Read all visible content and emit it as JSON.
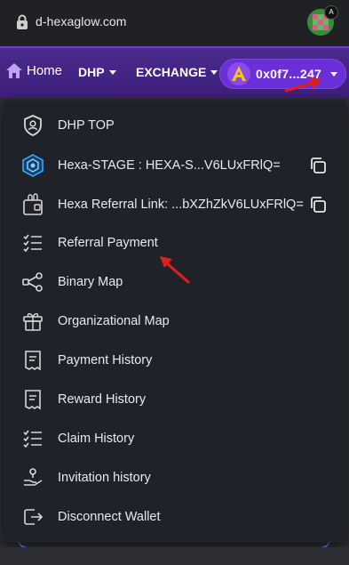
{
  "browser": {
    "url": "d-hexaglow.com",
    "avatar_badge": "A"
  },
  "nav": {
    "home_label": "Home",
    "dhp_label": "DHP",
    "exchange_label": "EXCHANGE",
    "wallet_address": "0x0f7...247"
  },
  "menu": {
    "items": [
      {
        "label": "DHP TOP",
        "icon": "shield-user-icon"
      },
      {
        "label": "Hexa-STAGE : HEXA-S...V6LUxFRlQ=",
        "icon": "hexagon-stage-icon",
        "copy": true
      },
      {
        "label": "Hexa Referral Link: ...bXZhZkV6LUxFRlQ=",
        "icon": "referral-link-icon",
        "copy": true
      },
      {
        "label": "Referral Payment",
        "icon": "checklist-icon"
      },
      {
        "label": "Binary Map",
        "icon": "share-nodes-icon"
      },
      {
        "label": "Organizational Map",
        "icon": "gift-box-icon"
      },
      {
        "label": "Payment History",
        "icon": "receipt-icon"
      },
      {
        "label": "Reward History",
        "icon": "receipt-icon"
      },
      {
        "label": "Claim History",
        "icon": "checklist-icon"
      },
      {
        "label": "Invitation history",
        "icon": "hand-coin-icon"
      },
      {
        "label": "Disconnect Wallet",
        "icon": "logout-icon"
      }
    ]
  },
  "colors": {
    "nav_bg": "#4a2a8c",
    "wallet_btn": "#6a2fd6",
    "menu_bg": "#1f2228",
    "annotation_arrow": "#e01e1e"
  }
}
